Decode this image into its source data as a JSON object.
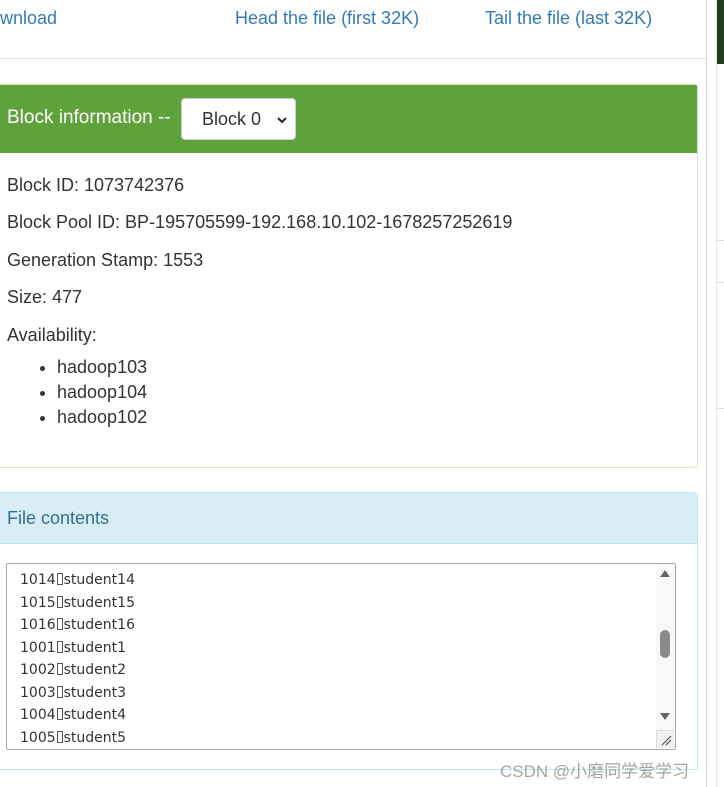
{
  "links": {
    "download": "ownload",
    "head": "Head the file (first 32K)",
    "tail": "Tail the file (last 32K)"
  },
  "block_panel": {
    "heading": "Block information --",
    "select_value": "Block 0",
    "block_id": "Block ID: 1073742376",
    "block_pool_id": "Block Pool ID: BP-195705599-192.168.10.102-1678257252619",
    "generation_stamp": "Generation Stamp: 1553",
    "size": "Size: 477",
    "availability_label": "Availability:",
    "hosts": [
      "hadoop103",
      "hadoop104",
      "hadoop102"
    ]
  },
  "file_panel": {
    "heading": "File contents",
    "lines": [
      {
        "id": "1014",
        "name": "student14"
      },
      {
        "id": "1015",
        "name": "student15"
      },
      {
        "id": "1016",
        "name": "student16"
      },
      {
        "id": "1001",
        "name": "student1"
      },
      {
        "id": "1002",
        "name": "student2"
      },
      {
        "id": "1003",
        "name": "student3"
      },
      {
        "id": "1004",
        "name": "student4"
      },
      {
        "id": "1005",
        "name": "student5"
      }
    ]
  },
  "watermark": "CSDN @小磨同学爱学习",
  "colors": {
    "success_heading": "#5fa13b",
    "info_heading": "#d9edf7",
    "link": "#337ab7"
  }
}
